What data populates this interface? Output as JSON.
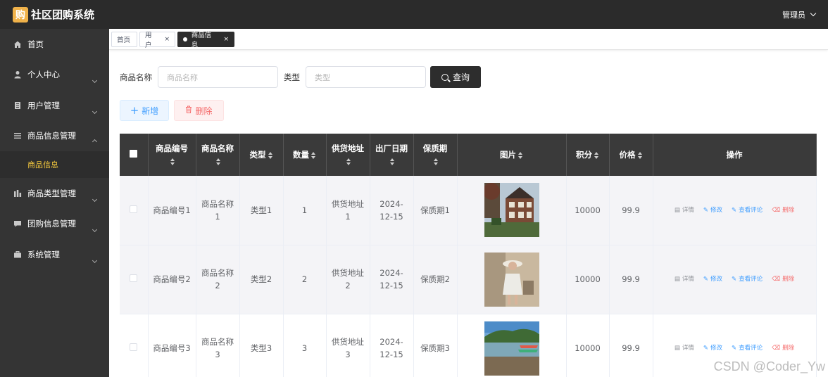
{
  "app": {
    "logo_char": "购",
    "title": "社区团购系统",
    "user": "管理员"
  },
  "sidebar": {
    "items": [
      {
        "label": "首页"
      },
      {
        "label": "个人中心"
      },
      {
        "label": "用户管理"
      },
      {
        "label": "商品信息管理"
      },
      {
        "label": "商品信息"
      },
      {
        "label": "商品类型管理"
      },
      {
        "label": "团购信息管理"
      },
      {
        "label": "系统管理"
      }
    ]
  },
  "tabs": [
    {
      "label": "首页"
    },
    {
      "label": "用户",
      "close": "×"
    },
    {
      "label": "商品信息",
      "close": "×"
    }
  ],
  "search": {
    "name_label": "商品名称",
    "name_placeholder": "商品名称",
    "type_label": "类型",
    "type_placeholder": "类型",
    "query_label": "查询"
  },
  "actions": {
    "add_label": "新增",
    "delete_label": "删除"
  },
  "table": {
    "headers": [
      "商品编号",
      "商品名称",
      "类型",
      "数量",
      "供货地址",
      "出厂日期",
      "保质期",
      "图片",
      "积分",
      "价格",
      "操作"
    ],
    "rows": [
      {
        "id": "商品编号1",
        "name": "商品名称1",
        "type": "类型1",
        "qty": "1",
        "addr": "供货地址1",
        "date": "2024-12-15",
        "shelf": "保质期1",
        "points": "10000",
        "price": "99.9"
      },
      {
        "id": "商品编号2",
        "name": "商品名称2",
        "type": "类型2",
        "qty": "2",
        "addr": "供货地址2",
        "date": "2024-12-15",
        "shelf": "保质期2",
        "points": "10000",
        "price": "99.9"
      },
      {
        "id": "商品编号3",
        "name": "商品名称3",
        "type": "类型3",
        "qty": "3",
        "addr": "供货地址3",
        "date": "2024-12-15",
        "shelf": "保质期3",
        "points": "10000",
        "price": "99.9"
      }
    ],
    "row_actions": {
      "detail": "详情",
      "edit": "修改",
      "review": "查看评论",
      "delete": "删除"
    }
  },
  "watermark": "CSDN @Coder_Yw",
  "colors": {
    "topbar": "#2b2b2b",
    "sidebar": "#343434",
    "active_menu": "#f3c73d",
    "primary": "#409eff",
    "danger": "#f56c6c"
  }
}
